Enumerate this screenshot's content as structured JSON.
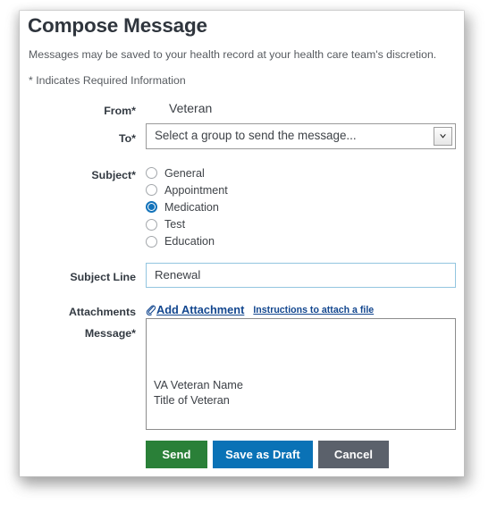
{
  "card": {
    "title": "Compose Message",
    "subtitle": "Messages may be saved to your health record at your health care team's discretion.",
    "required_note": "* Indicates Required Information"
  },
  "form": {
    "from": {
      "label": "From*",
      "value": "Veteran"
    },
    "to": {
      "label": "To*",
      "selected_option": "Select a group to send the message...",
      "arrow_icon": "chevron-down-icon"
    },
    "subject": {
      "label": "Subject*",
      "options": [
        {
          "label": "General",
          "checked": false
        },
        {
          "label": "Appointment",
          "checked": false
        },
        {
          "label": "Medication",
          "checked": true
        },
        {
          "label": "Test",
          "checked": false
        },
        {
          "label": "Education",
          "checked": false
        }
      ]
    },
    "subject_line": {
      "label": "Subject Line",
      "value": "Renewal"
    },
    "attachments": {
      "label": "Attachments",
      "add_icon": "paperclip-icon",
      "add_link": "Add Attachment",
      "instructions_link": "Instructions to attach a file"
    },
    "message": {
      "label": "Message*",
      "value": "VA Veteran Name\nTitle of Veteran"
    }
  },
  "actions": {
    "send": "Send",
    "save_draft": "Save as Draft",
    "cancel": "Cancel"
  },
  "colors": {
    "send_green": "#2a8038",
    "draft_blue": "#0a72b6",
    "cancel_gray": "#5b616b",
    "radio_selected_blue": "#1373ba",
    "link_blue": "#13478f",
    "focus_border": "#93c6e0",
    "heading": "#2f353d"
  }
}
